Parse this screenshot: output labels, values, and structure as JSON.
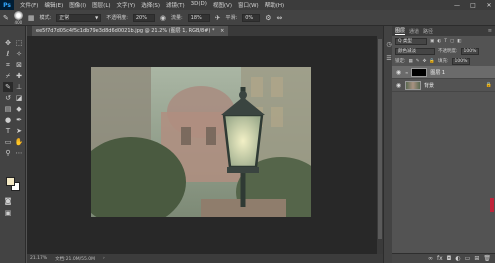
{
  "menubar": {
    "logo": "Ps",
    "items": [
      "文件(F)",
      "编辑(E)",
      "图像(I)",
      "图层(L)",
      "文字(Y)",
      "选择(S)",
      "滤镜(T)",
      "3D(D)",
      "视图(V)",
      "窗口(W)",
      "帮助(H)"
    ],
    "window_controls": [
      "—",
      "□",
      "✕"
    ]
  },
  "options_bar": {
    "brush_size": "400",
    "mode_label": "模式:",
    "mode_value": "正常",
    "opacity_label": "不透明度:",
    "opacity_value": "20%",
    "flow_label": "流量:",
    "flow_value": "18%",
    "smoothing_label": "平滑:",
    "smoothing_value": "0%"
  },
  "document": {
    "tab_title": "ee5f7d7d05c4f5c1db79e3d8d6d0021b.jpg @ 21.2% (图层 1, RGB/8#) *",
    "close": "×"
  },
  "status_bar": {
    "zoom": "21.17%",
    "doc_size": "文档:21.0M/55.0M"
  },
  "colors": {
    "foreground": "#f4e9c4",
    "background": "#ffffff"
  },
  "layers_panel": {
    "tabs": [
      "图层",
      "通道",
      "路径"
    ],
    "kind_label": "Q 类型",
    "blend_mode": "颜色减淡",
    "opacity_label": "不透明度:",
    "opacity_value": "100%",
    "lock_label": "锁定:",
    "fill_label": "填充:",
    "fill_value": "100%",
    "layers": [
      {
        "name": "图层 1",
        "selected": true
      },
      {
        "name": "背景",
        "selected": false
      }
    ],
    "footer_icons": [
      "link-icon",
      "fx-icon",
      "mask-icon",
      "adjustment-icon",
      "group-icon",
      "new-layer-icon",
      "trash-icon"
    ]
  }
}
